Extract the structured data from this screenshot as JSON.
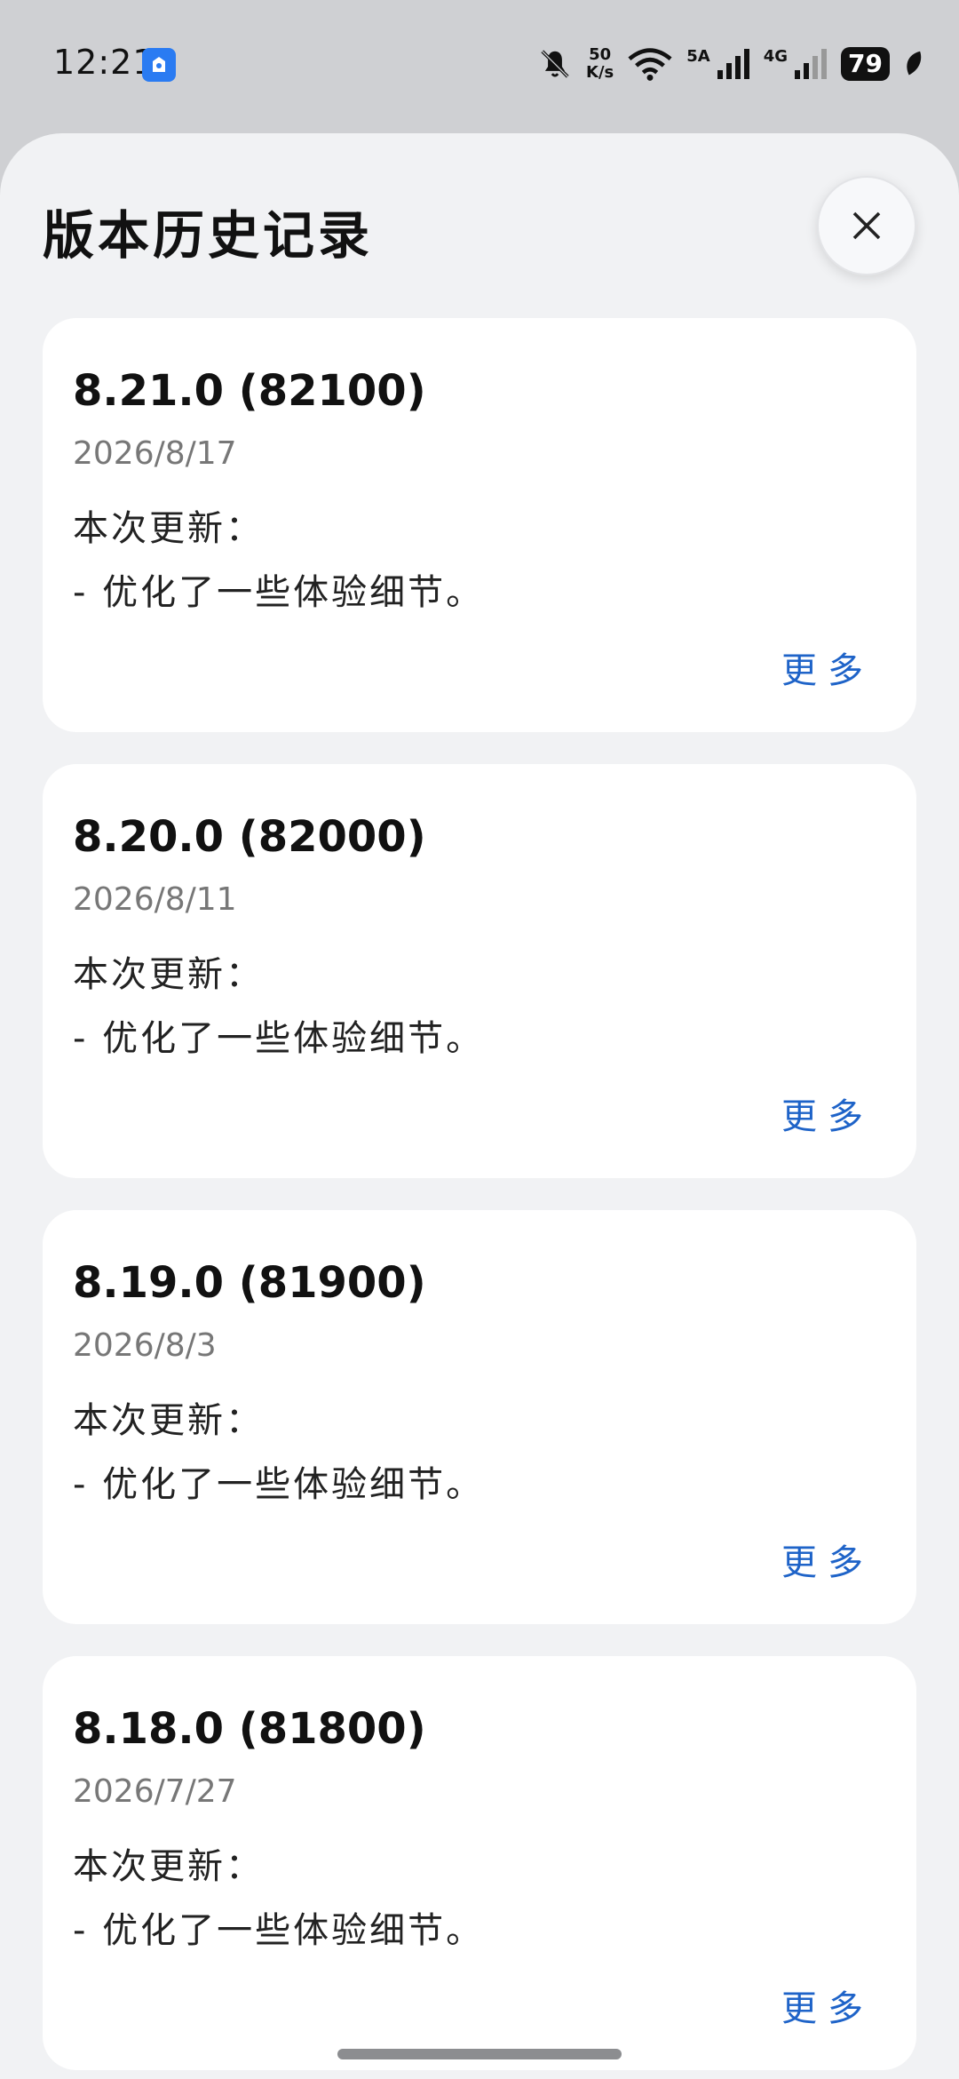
{
  "status_bar": {
    "time": "12:21",
    "speed_value": "50",
    "speed_unit": "K/s",
    "sim1_label": "5A",
    "sim2_label": "4G",
    "battery": "79"
  },
  "sheet": {
    "title": "版本历史记录",
    "close_icon": "close-icon"
  },
  "versions": [
    {
      "version": "8.21.0 (82100)",
      "date": "2026/8/17",
      "heading": "本次更新：",
      "note": "- 优化了一些体验细节。",
      "more": "更多"
    },
    {
      "version": "8.20.0 (82000)",
      "date": "2026/8/11",
      "heading": "本次更新：",
      "note": "- 优化了一些体验细节。",
      "more": "更多"
    },
    {
      "version": "8.19.0 (81900)",
      "date": "2026/8/3",
      "heading": "本次更新：",
      "note": "- 优化了一些体验细节。",
      "more": "更多"
    },
    {
      "version": "8.18.0 (81800)",
      "date": "2026/7/27",
      "heading": "本次更新：",
      "note": "- 优化了一些体验细节。",
      "more": "更多"
    }
  ],
  "colors": {
    "accent": "#1e63c8",
    "sheet_bg": "#f1f2f4",
    "card_bg": "#ffffff"
  }
}
